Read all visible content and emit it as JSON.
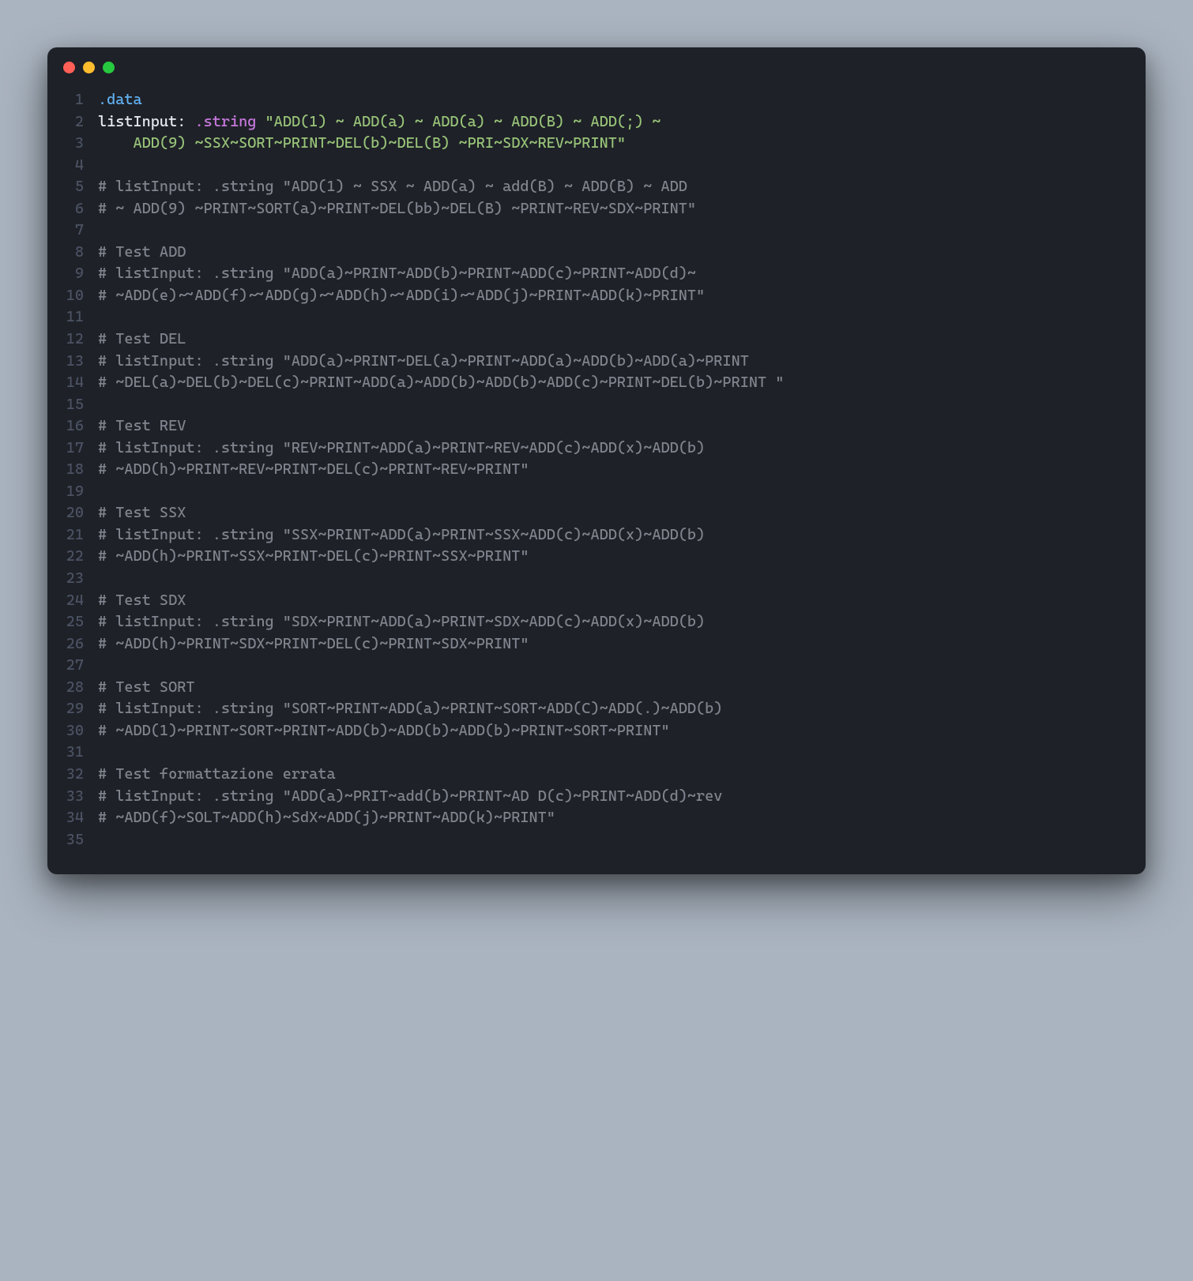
{
  "titlebar": {
    "buttons": [
      "close",
      "minimize",
      "zoom"
    ]
  },
  "lines": [
    {
      "n": 1,
      "tokens": [
        {
          "t": "directive",
          "v": ".data"
        }
      ]
    },
    {
      "n": 2,
      "tokens": [
        {
          "t": "label",
          "v": "listInput:"
        },
        {
          "t": "plain",
          "v": " "
        },
        {
          "t": "keyword",
          "v": ".string"
        },
        {
          "t": "plain",
          "v": " "
        },
        {
          "t": "string",
          "v": "\"ADD(1) ~ ADD(a) ~ ADD(a) ~ ADD(B) ~ ADD(;) ~ "
        }
      ]
    },
    {
      "n": 3,
      "tokens": [
        {
          "t": "string",
          "v": "    ADD(9) ~SSX~SORT~PRINT~DEL(b)~DEL(B) ~PRI~SDX~REV~PRINT\""
        }
      ]
    },
    {
      "n": 4,
      "tokens": []
    },
    {
      "n": 5,
      "tokens": [
        {
          "t": "comment",
          "v": "# listInput: .string \"ADD(1) ~ SSX ~ ADD(a) ~ add(B) ~ ADD(B) ~ ADD "
        }
      ]
    },
    {
      "n": 6,
      "tokens": [
        {
          "t": "comment",
          "v": "# ~ ADD(9) ~PRINT~SORT(a)~PRINT~DEL(bb)~DEL(B) ~PRINT~REV~SDX~PRINT\""
        }
      ]
    },
    {
      "n": 7,
      "tokens": []
    },
    {
      "n": 8,
      "tokens": [
        {
          "t": "comment",
          "v": "# Test ADD"
        }
      ]
    },
    {
      "n": 9,
      "tokens": [
        {
          "t": "comment",
          "v": "# listInput: .string \"ADD(a)~PRINT~ADD(b)~PRINT~ADD(c)~PRINT~ADD(d)~"
        }
      ]
    },
    {
      "n": 10,
      "tokens": [
        {
          "t": "comment",
          "v": "# ~ADD(e)~~ADD(f)~~ADD(g)~~ADD(h)~~ADD(i)~~ADD(j)~PRINT~ADD(k)~PRINT\""
        }
      ]
    },
    {
      "n": 11,
      "tokens": []
    },
    {
      "n": 12,
      "tokens": [
        {
          "t": "comment",
          "v": "# Test DEL"
        }
      ]
    },
    {
      "n": 13,
      "tokens": [
        {
          "t": "comment",
          "v": "# listInput: .string \"ADD(a)~PRINT~DEL(a)~PRINT~ADD(a)~ADD(b)~ADD(a)~PRINT"
        }
      ]
    },
    {
      "n": 14,
      "tokens": [
        {
          "t": "comment",
          "v": "# ~DEL(a)~DEL(b)~DEL(c)~PRINT~ADD(a)~ADD(b)~ADD(b)~ADD(c)~PRINT~DEL(b)~PRINT \""
        }
      ]
    },
    {
      "n": 15,
      "tokens": []
    },
    {
      "n": 16,
      "tokens": [
        {
          "t": "comment",
          "v": "# Test REV"
        }
      ]
    },
    {
      "n": 17,
      "tokens": [
        {
          "t": "comment",
          "v": "# listInput: .string \"REV~PRINT~ADD(a)~PRINT~REV~ADD(c)~ADD(x)~ADD(b)"
        }
      ]
    },
    {
      "n": 18,
      "tokens": [
        {
          "t": "comment",
          "v": "# ~ADD(h)~PRINT~REV~PRINT~DEL(c)~PRINT~REV~PRINT\""
        }
      ]
    },
    {
      "n": 19,
      "tokens": []
    },
    {
      "n": 20,
      "tokens": [
        {
          "t": "comment",
          "v": "# Test SSX"
        }
      ]
    },
    {
      "n": 21,
      "tokens": [
        {
          "t": "comment",
          "v": "# listInput: .string \"SSX~PRINT~ADD(a)~PRINT~SSX~ADD(c)~ADD(x)~ADD(b)"
        }
      ]
    },
    {
      "n": 22,
      "tokens": [
        {
          "t": "comment",
          "v": "# ~ADD(h)~PRINT~SSX~PRINT~DEL(c)~PRINT~SSX~PRINT\""
        }
      ]
    },
    {
      "n": 23,
      "tokens": []
    },
    {
      "n": 24,
      "tokens": [
        {
          "t": "comment",
          "v": "# Test SDX"
        }
      ]
    },
    {
      "n": 25,
      "tokens": [
        {
          "t": "comment",
          "v": "# listInput: .string \"SDX~PRINT~ADD(a)~PRINT~SDX~ADD(c)~ADD(x)~ADD(b)"
        }
      ]
    },
    {
      "n": 26,
      "tokens": [
        {
          "t": "comment",
          "v": "# ~ADD(h)~PRINT~SDX~PRINT~DEL(c)~PRINT~SDX~PRINT\""
        }
      ]
    },
    {
      "n": 27,
      "tokens": []
    },
    {
      "n": 28,
      "tokens": [
        {
          "t": "comment",
          "v": "# Test SORT"
        }
      ]
    },
    {
      "n": 29,
      "tokens": [
        {
          "t": "comment",
          "v": "# listInput: .string \"SORT~PRINT~ADD(a)~PRINT~SORT~ADD(C)~ADD(.)~ADD(b)"
        }
      ]
    },
    {
      "n": 30,
      "tokens": [
        {
          "t": "comment",
          "v": "# ~ADD(1)~PRINT~SORT~PRINT~ADD(b)~ADD(b)~ADD(b)~PRINT~SORT~PRINT\""
        }
      ]
    },
    {
      "n": 31,
      "tokens": []
    },
    {
      "n": 32,
      "tokens": [
        {
          "t": "comment",
          "v": "# Test formattazione errata"
        }
      ]
    },
    {
      "n": 33,
      "tokens": [
        {
          "t": "comment",
          "v": "# listInput: .string \"ADD(a)~PRIT~add(b)~PRINT~AD D(c)~PRINT~ADD(d)~rev"
        }
      ]
    },
    {
      "n": 34,
      "tokens": [
        {
          "t": "comment",
          "v": "# ~ADD(f)~SOLT~ADD(h)~SdX~ADD(j)~PRINT~ADD(k)~PRINT\""
        }
      ]
    },
    {
      "n": 35,
      "tokens": []
    }
  ]
}
